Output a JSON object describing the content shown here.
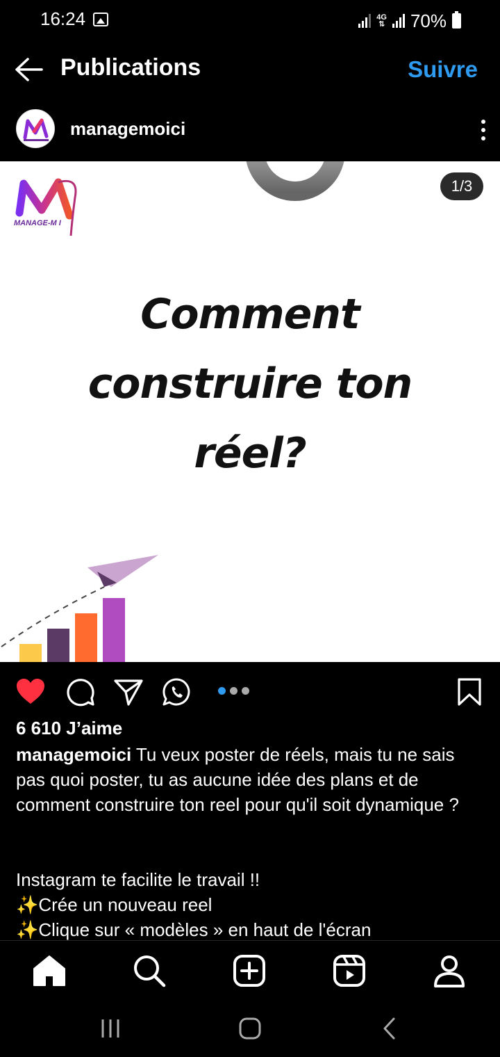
{
  "status": {
    "time": "16:24",
    "network": "4G",
    "battery": "70%",
    "icons": [
      "image-icon",
      "signal-icon",
      "4g-icon",
      "signal-icon",
      "battery-icon"
    ]
  },
  "header": {
    "title": "Publications",
    "follow_label": "Suivre"
  },
  "post": {
    "username": "managemoici",
    "slide_counter": "1/3",
    "slide_count": 3,
    "active_slide": 1,
    "image": {
      "brand_text": "MANAGE-M  I",
      "headline": [
        "Comment",
        "construire ton",
        "réel?"
      ],
      "bar_colors": [
        "#fdc94b",
        "#5c3a66",
        "#ff6a2f",
        "#b04cc0"
      ]
    },
    "likes": "6 610 J’aime",
    "caption_user": "managemoici",
    "caption_text": " Tu veux poster de réels, mais tu ne sais pas quoi poster, tu as aucune idée des plans et de comment construire ton reel pour qu'il soit dynamique ?",
    "caption_lines": [
      "Instagram te facilite le travail !!",
      "Crée un nouveau reel",
      "Clique sur « modèles » en haut de l'écran"
    ],
    "sparkle": "✨"
  },
  "colors": {
    "accent": "#2f9bf0",
    "like": "#ff3040",
    "background": "#000000"
  },
  "nav": [
    "home-icon",
    "search-icon",
    "create-icon",
    "reels-icon",
    "profile-icon"
  ]
}
